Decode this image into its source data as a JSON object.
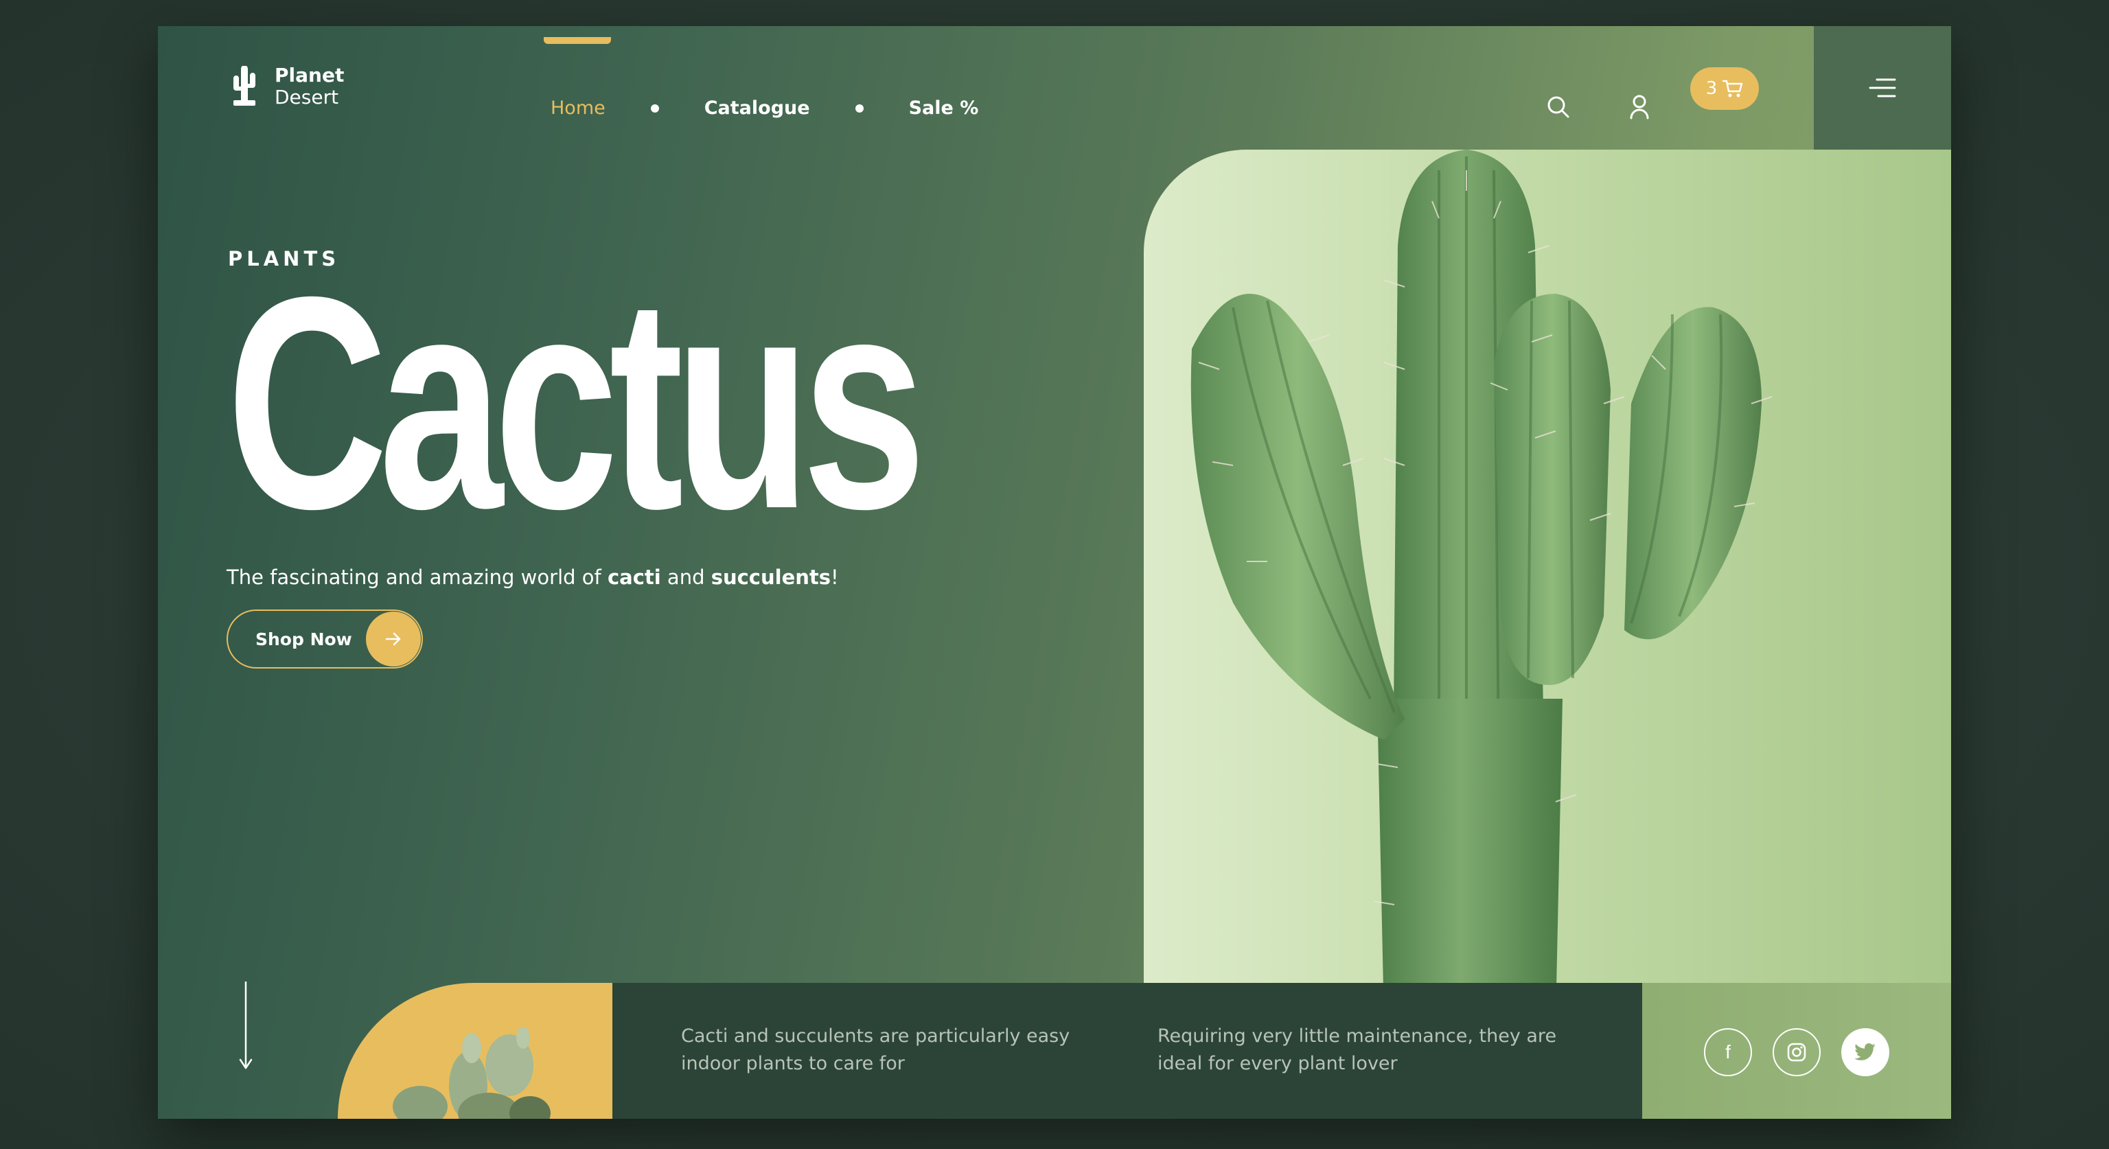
{
  "brand": {
    "line1": "Planet",
    "line2": "Desert"
  },
  "nav": {
    "items": [
      {
        "label": "Home",
        "active": true
      },
      {
        "label": "Catalogue",
        "active": false
      },
      {
        "label": "Sale %",
        "active": false
      }
    ]
  },
  "header": {
    "icons": [
      "search-icon",
      "user-icon",
      "cart-icon",
      "menu-icon"
    ],
    "cart_count": "3"
  },
  "hero": {
    "eyebrow": "PLANTS",
    "title": "Cactus",
    "subtitle_parts": [
      "The fascinating and amazing world of ",
      "cacti",
      " and ",
      "succulents",
      "!"
    ],
    "cta_label": "Shop Now"
  },
  "bottom": {
    "text1": "Cacti and succulents are particularly easy indoor plants to care for",
    "text2": "Requiring very little maintenance, they are ideal for every plant lover",
    "social": [
      {
        "name": "facebook-icon",
        "glyph": "f"
      },
      {
        "name": "instagram-icon",
        "glyph": ""
      },
      {
        "name": "twitter-icon",
        "glyph": ""
      }
    ]
  },
  "colors": {
    "accent": "#e8bd5e",
    "dark_green": "#2c4338",
    "panel_green": "#c3dba8"
  }
}
